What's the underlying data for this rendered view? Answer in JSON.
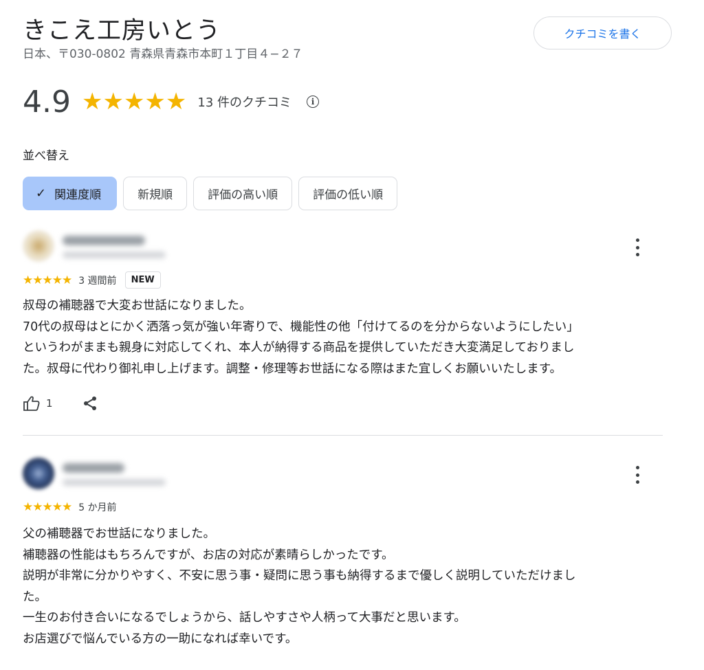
{
  "place": {
    "name": "きこえ工房いとう",
    "address": "日本、〒030-0802 青森県青森市本町１丁目４−２７"
  },
  "write_review_label": "クチコミを書く",
  "summary": {
    "rating": "4.9",
    "stars": "★★★★★",
    "review_count": "13 件のクチコミ",
    "info_icon": "i"
  },
  "sort": {
    "label": "並べ替え",
    "check": "✓",
    "options": [
      {
        "label": "関連度順",
        "selected": true
      },
      {
        "label": "新規順",
        "selected": false
      },
      {
        "label": "評価の高い順",
        "selected": false
      },
      {
        "label": "評価の低い順",
        "selected": false
      }
    ]
  },
  "reviews": [
    {
      "stars": "★★★★★",
      "when": "3 週間前",
      "badge": "NEW",
      "lines": [
        "叔母の補聴器で大変お世話になりました。",
        "70代の叔母はとにかく洒落っ気が強い年寄りで、機能性の他「付けてるのを分からないようにしたい」",
        "というわがままも親身に対応してくれ、本人が納得する商品を提供していただき大変満足しておりまし",
        "た。叔母に代わり御礼申し上げます。調整・修理等お世話になる際はまた宜しくお願いいたします。"
      ],
      "likes": "1"
    },
    {
      "stars": "★★★★★",
      "when": "5 か月前",
      "lines": [
        "父の補聴器でお世話になりました。",
        "補聴器の性能はもちろんですが、お店の対応が素晴らしかったです。",
        "説明が非常に分かりやすく、不安に思う事・疑問に思う事も納得するまで優しく説明していただけまし",
        "た。",
        "一生のお付き合いになるでしょうから、話しやすさや人柄って大事だと思います。",
        "お店選びで悩んでいる方の一助になれば幸いです。"
      ]
    }
  ],
  "colors": {
    "star": "#f4b400",
    "accent": "#1a73e8",
    "chip_selected": "#a8c7fa"
  }
}
